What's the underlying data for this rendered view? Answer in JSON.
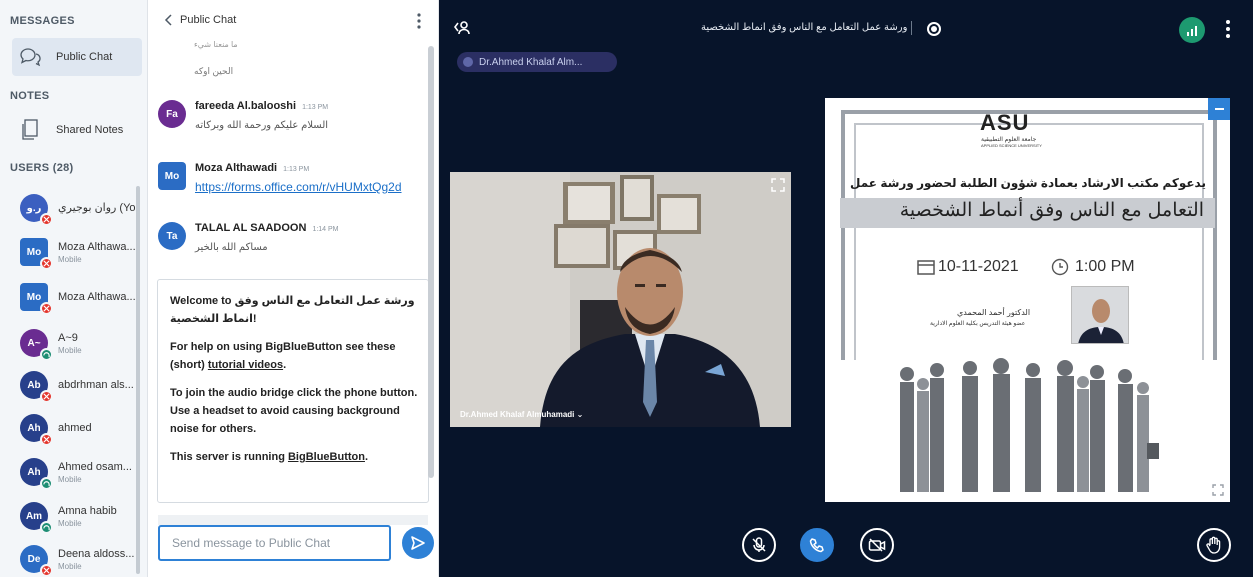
{
  "sidebar": {
    "messages_heading": "MESSAGES",
    "public_chat_label": "Public Chat",
    "notes_heading": "NOTES",
    "shared_notes_label": "Shared Notes",
    "users_heading": "USERS (28)",
    "users": [
      {
        "initials": "ر.و",
        "name": "روان بوجيري (You)",
        "sub": "",
        "color": "#3b5fc0",
        "badge": "red",
        "square": false
      },
      {
        "initials": "Mo",
        "name": "Moza Althawa...",
        "sub": "Mobile",
        "color": "#2b6cc4",
        "badge": "red",
        "square": true
      },
      {
        "initials": "Mo",
        "name": "Moza Althawa...",
        "sub": "",
        "color": "#2b6cc4",
        "badge": "red",
        "square": true
      },
      {
        "initials": "A~",
        "name": "A~9",
        "sub": "Mobile",
        "color": "#6a2c91",
        "badge": "green",
        "square": false
      },
      {
        "initials": "Ab",
        "name": "abdrhman als...",
        "sub": "",
        "color": "#27408b",
        "badge": "red",
        "square": false
      },
      {
        "initials": "Ah",
        "name": "ahmed",
        "sub": "",
        "color": "#27408b",
        "badge": "red",
        "square": false
      },
      {
        "initials": "Ah",
        "name": "Ahmed osam...",
        "sub": "Mobile",
        "color": "#27408b",
        "badge": "green",
        "square": false
      },
      {
        "initials": "Am",
        "name": "Amna habib",
        "sub": "Mobile",
        "color": "#27408b",
        "badge": "green",
        "square": false
      },
      {
        "initials": "De",
        "name": "Deena aldoss...",
        "sub": "Mobile",
        "color": "#2b6cc4",
        "badge": "red",
        "square": false
      }
    ]
  },
  "chat": {
    "back_label": "Public Chat",
    "partial_top": "ما منعنا شيء",
    "partial_text": "الحين اوكه",
    "messages": [
      {
        "initials": "Fa",
        "name": "fareeda Al.balooshi",
        "time": "1:13 PM",
        "text": "السلام عليكم ورحمة الله وبركاته",
        "color": "#6a2c91",
        "square": false,
        "link": false
      },
      {
        "initials": "Mo",
        "name": "Moza Althawadi",
        "time": "1:13 PM",
        "text": "https://forms.office.com/r/vHUMxtQg2d",
        "color": "#2b6cc4",
        "square": true,
        "link": true
      },
      {
        "initials": "Ta",
        "name": "TALAL AL SAADOON",
        "time": "1:14 PM",
        "text": "مساكم الله بالخير",
        "color": "#2b6cc4",
        "square": false,
        "link": false
      }
    ],
    "welcome": {
      "p1_prefix": "Welcome to",
      "p1_arabic": "ورشة عمل التعامل مع الناس وفق انماط الشخصية",
      "p1_suffix": "!",
      "p2": "For help on using BigBlueButton see these (short)",
      "p2_link": "tutorial videos",
      "p2_end": ".",
      "p3": "To join the audio bridge click the phone button. Use a headset to avoid causing background noise for others.",
      "p4": "This server is running",
      "p4_link": "BigBlueButton",
      "p4_end": "."
    },
    "input_placeholder": "Send message to Public Chat"
  },
  "main": {
    "meeting_title": "ورشة عمل التعامل مع الناس وفق انماط الشخصية",
    "talker_name": "Dr.Ahmed Khalaf Alm...",
    "webcam_name": "Dr.Ahmed Khalaf Almuhamadi ⌄",
    "slide": {
      "logo": "ASU",
      "logo_ar": "جامعة العلوم التطبيقية",
      "logo_en": "APPLIED SCIENCE UNIVERSITY",
      "line1": "يدعوكم مكتب الارشاد بعمادة شؤون الطلبة لحضور ورشة عمل",
      "line2": "التعامل مع الناس وفق أنماط الشخصية",
      "date": "10-11-2021",
      "time": "1:00 PM",
      "dr_name": "الدكتور أحمد المحمدي",
      "dr_title": "عضو هيئة التدريس بكلية العلوم الادارية"
    }
  },
  "colors": {
    "accent": "#2e81d6",
    "main_bg": "#07142a",
    "status_green": "#1d9a70",
    "status_red": "#e4362d"
  }
}
